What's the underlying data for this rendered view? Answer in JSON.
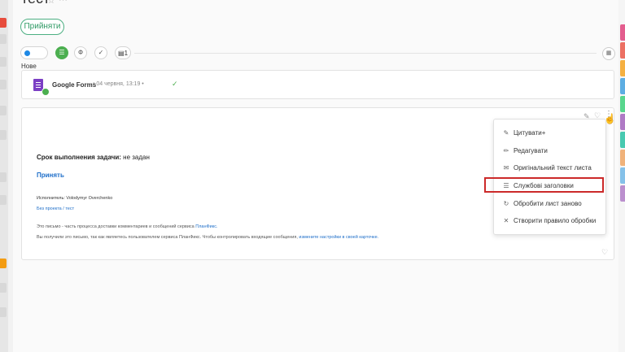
{
  "task": {
    "title": "тест",
    "star_icon": "star-icon",
    "more_icon": "more-icon",
    "accept_button": "Прийняти"
  },
  "status": {
    "label": "Нове",
    "dot_color": "#1e88e5",
    "pill_glyph": "Ф",
    "counter": "1"
  },
  "email_header": {
    "sender": "Google Forms",
    "meta": "• 04 червня, 13:19 •",
    "check": "✓"
  },
  "email_body": {
    "term_label": "Срок выполнения задачи:",
    "term_value": " не задан",
    "accept_link": "Принять",
    "executors": "Исполнитель: Volodymyr Overchenko",
    "project_link": "Без проекта / тест",
    "footer1_text": "Это письмо - часть процесса доставки комментариев и сообщений сервиса ",
    "footer1_link": "ПланФикс.",
    "footer2_text": "Вы получили это письмо, так как являетесь пользователем сервиса ПланФикс. Чтобы контролировать входящие сообщения, ",
    "footer2_link": "измените настройки в своей карточке."
  },
  "context_menu": {
    "items": [
      {
        "label": "Цитувати+",
        "icon": "quote-icon",
        "glyph": "✎"
      },
      {
        "label": "Редагувати",
        "icon": "pencil-icon",
        "glyph": "✏"
      },
      {
        "label": "Оригінальний текст листа",
        "icon": "mail-icon",
        "glyph": "✉"
      },
      {
        "label": "Службові заголовки",
        "icon": "headers-icon",
        "glyph": "☰",
        "highlighted": true
      },
      {
        "label": "Обробити лист заново",
        "icon": "refresh-icon",
        "glyph": "↻"
      },
      {
        "label": "Створити правило обробки",
        "icon": "rule-icon",
        "glyph": "✕"
      }
    ],
    "highlight_color": "#cc2a2a"
  }
}
